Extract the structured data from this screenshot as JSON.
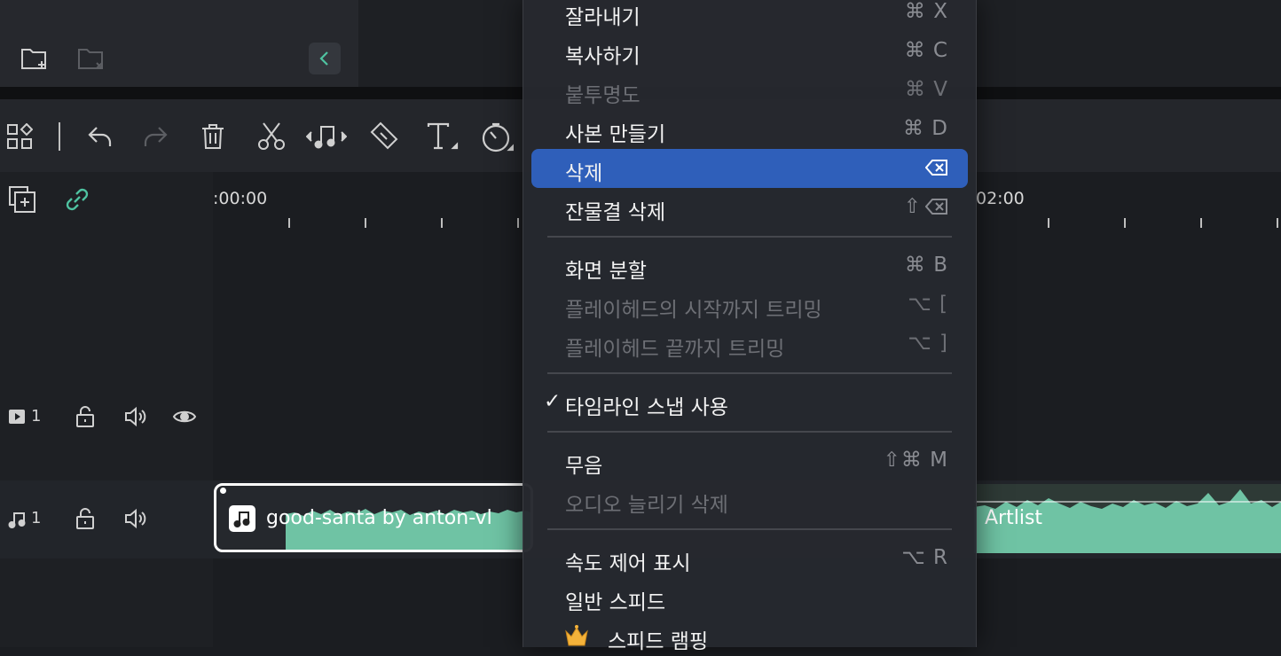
{
  "timeline": {
    "ruler_start": ":00:00",
    "ruler_end": "02:00"
  },
  "tracks": {
    "video_track_number": "1",
    "audio_track_number": "1"
  },
  "audio_clip": {
    "title_left": "good-santa by anton-vl",
    "title_right": "Artlist"
  },
  "context_menu": {
    "items": [
      {
        "label": "잘라내기",
        "shortcut": "⌘ X",
        "state": "normal"
      },
      {
        "label": "복사하기",
        "shortcut": "⌘ C",
        "state": "normal"
      },
      {
        "label": "붙투명도",
        "shortcut": "⌘ V",
        "state": "disabled"
      },
      {
        "label": "사본 만들기",
        "shortcut": "⌘ D",
        "state": "normal"
      },
      {
        "label": "삭제",
        "shortcut": "",
        "state": "selected"
      },
      {
        "label": "잔물결 삭제",
        "shortcut": "⇧",
        "state": "normal"
      },
      {
        "label": "화면 분할",
        "shortcut": "⌘ B",
        "state": "normal"
      },
      {
        "label": "플레이헤드의 시작까지 트리밍",
        "shortcut": "⌥ [",
        "state": "disabled"
      },
      {
        "label": "플레이헤드 끝까지 트리밍",
        "shortcut": "⌥ ]",
        "state": "disabled"
      },
      {
        "label": "타임라인 스냅 사용",
        "shortcut": "",
        "state": "checked"
      },
      {
        "label": "무음",
        "shortcut": "⇧⌘ M",
        "state": "normal"
      },
      {
        "label": "오디오 늘리기 삭제",
        "shortcut": "",
        "state": "disabled"
      },
      {
        "label": "속도 제어 표시",
        "shortcut": "⌥ R",
        "state": "normal"
      },
      {
        "label": "일반 스피드",
        "shortcut": "",
        "state": "normal"
      },
      {
        "label": "스피드 램핑",
        "shortcut": "",
        "state": "normal"
      }
    ]
  },
  "colors": {
    "accent": "#2f5fba",
    "waveform": "#6fc3a4",
    "link_icon": "#4fc3a1"
  }
}
